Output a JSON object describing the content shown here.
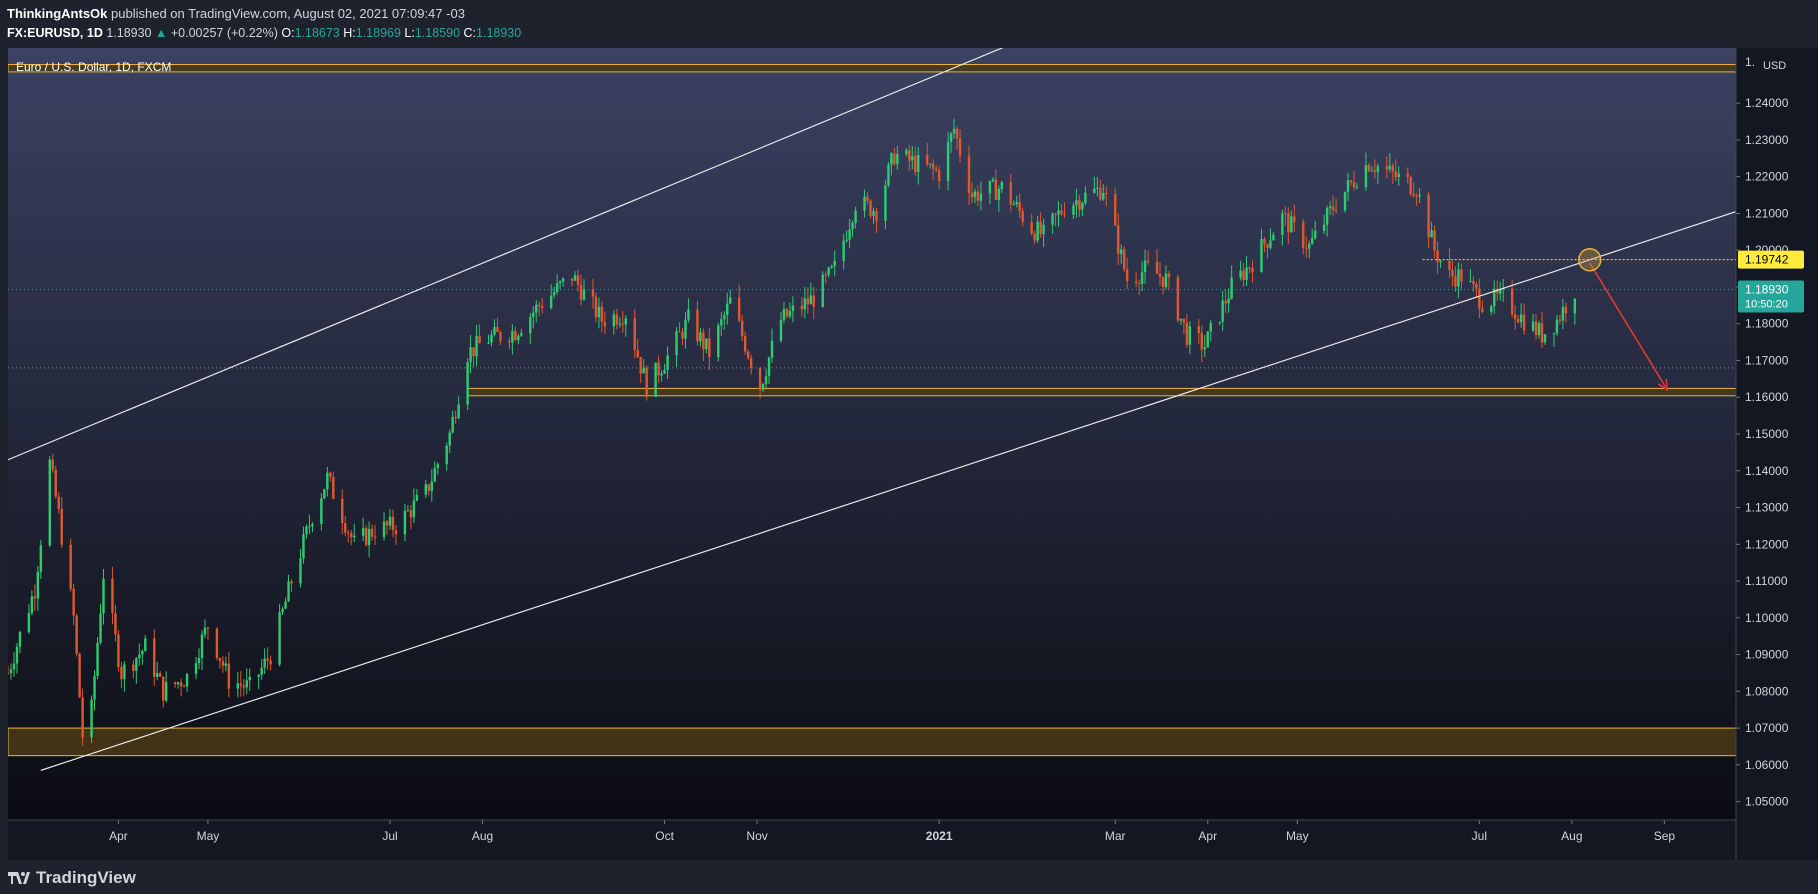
{
  "header": {
    "author": "ThinkingAntsOk",
    "published_text": "published on TradingView.com, August 02, 2021 07:09:47 -03",
    "symbol": "FX:EURUSD, 1D",
    "last": "1.18930",
    "change": "+0.00257 (+0.22%)",
    "open_label": "O:",
    "open": "1.18673",
    "high_label": "H:",
    "high": "1.18969",
    "low_label": "L:",
    "low": "1.18590",
    "close_label": "C:",
    "close": "1.18930"
  },
  "footer": {
    "brand": "TradingView"
  },
  "colors": {
    "background_top": "#3b4262",
    "background_bottom": "#0b0c12",
    "up": "#26a69a",
    "up_candle": "#2ecc71",
    "down_candle": "#e0582b",
    "zone_fill": "#4a3a14",
    "zone_border": "#f0b43a",
    "trend_line": "#e8e8e8",
    "arrow": "#e53935",
    "highlight_label": "#ffeb3b",
    "price_label": "#26a69a"
  },
  "chart_data": {
    "type": "candlestick",
    "title": "Euro / U.S. Dollar, 1D, FXCM",
    "currency": "USD",
    "x_range": [
      "2020-02-24",
      "2021-09-25"
    ],
    "ylim": [
      1.045,
      1.255
    ],
    "y_ticks": [
      "1.05000",
      "1.06000",
      "1.07000",
      "1.08000",
      "1.09000",
      "1.10000",
      "1.11000",
      "1.12000",
      "1.13000",
      "1.14000",
      "1.15000",
      "1.16000",
      "1.17000",
      "1.18000",
      "1.19000",
      "1.20000",
      "1.21000",
      "1.22000",
      "1.23000",
      "1.24000"
    ],
    "y_axis_top_label": "1.",
    "x_ticks": [
      {
        "label": "Apr",
        "date": "2020-04-01"
      },
      {
        "label": "May",
        "date": "2020-05-01"
      },
      {
        "label": "Jul",
        "date": "2020-07-01"
      },
      {
        "label": "Aug",
        "date": "2020-08-01"
      },
      {
        "label": "Oct",
        "date": "2020-10-01"
      },
      {
        "label": "Nov",
        "date": "2020-11-01"
      },
      {
        "label": "2021",
        "date": "2021-01-01"
      },
      {
        "label": "Mar",
        "date": "2021-03-01"
      },
      {
        "label": "Apr",
        "date": "2021-04-01"
      },
      {
        "label": "May",
        "date": "2021-05-01"
      },
      {
        "label": "Jul",
        "date": "2021-07-01"
      },
      {
        "label": "Aug",
        "date": "2021-08-01"
      },
      {
        "label": "Sep",
        "date": "2021-09-01"
      }
    ],
    "close_path": [
      [
        "2020-02-24",
        1.085
      ],
      [
        "2020-03-04",
        1.108
      ],
      [
        "2020-03-09",
        1.142
      ],
      [
        "2020-03-12",
        1.128
      ],
      [
        "2020-03-17",
        1.1
      ],
      [
        "2020-03-20",
        1.068
      ],
      [
        "2020-03-23",
        1.075
      ],
      [
        "2020-03-27",
        1.112
      ],
      [
        "2020-04-02",
        1.085
      ],
      [
        "2020-04-10",
        1.092
      ],
      [
        "2020-04-16",
        1.08
      ],
      [
        "2020-04-24",
        1.084
      ],
      [
        "2020-05-01",
        1.098
      ],
      [
        "2020-05-08",
        1.083
      ],
      [
        "2020-05-15",
        1.081
      ],
      [
        "2020-05-22",
        1.09
      ],
      [
        "2020-05-29",
        1.11
      ],
      [
        "2020-06-05",
        1.128
      ],
      [
        "2020-06-10",
        1.138
      ],
      [
        "2020-06-19",
        1.12
      ],
      [
        "2020-06-26",
        1.124
      ],
      [
        "2020-07-03",
        1.125
      ],
      [
        "2020-07-13",
        1.134
      ],
      [
        "2020-07-21",
        1.15
      ],
      [
        "2020-07-27",
        1.172
      ],
      [
        "2020-08-03",
        1.176
      ],
      [
        "2020-08-12",
        1.178
      ],
      [
        "2020-08-20",
        1.185
      ],
      [
        "2020-08-31",
        1.193
      ],
      [
        "2020-09-10",
        1.181
      ],
      [
        "2020-09-18",
        1.183
      ],
      [
        "2020-09-25",
        1.163
      ],
      [
        "2020-10-02",
        1.171
      ],
      [
        "2020-10-09",
        1.181
      ],
      [
        "2020-10-16",
        1.172
      ],
      [
        "2020-10-23",
        1.186
      ],
      [
        "2020-11-02",
        1.163
      ],
      [
        "2020-11-09",
        1.181
      ],
      [
        "2020-11-20",
        1.187
      ],
      [
        "2020-11-27",
        1.195
      ],
      [
        "2020-12-04",
        1.213
      ],
      [
        "2020-12-11",
        1.211
      ],
      [
        "2020-12-17",
        1.226
      ],
      [
        "2021-01-01",
        1.221
      ],
      [
        "2021-01-06",
        1.233
      ],
      [
        "2021-01-12",
        1.215
      ],
      [
        "2021-01-22",
        1.217
      ],
      [
        "2021-02-01",
        1.206
      ],
      [
        "2021-02-05",
        1.204
      ],
      [
        "2021-02-12",
        1.212
      ],
      [
        "2021-02-25",
        1.217
      ],
      [
        "2021-03-05",
        1.192
      ],
      [
        "2021-03-12",
        1.195
      ],
      [
        "2021-03-18",
        1.192
      ],
      [
        "2021-03-25",
        1.177
      ],
      [
        "2021-03-31",
        1.174
      ],
      [
        "2021-04-09",
        1.19
      ],
      [
        "2021-04-16",
        1.197
      ],
      [
        "2021-04-26",
        1.209
      ],
      [
        "2021-05-05",
        1.201
      ],
      [
        "2021-05-14",
        1.213
      ],
      [
        "2021-05-25",
        1.224
      ],
      [
        "2021-06-01",
        1.221
      ],
      [
        "2021-06-10",
        1.217
      ],
      [
        "2021-06-16",
        1.2
      ],
      [
        "2021-06-21",
        1.193
      ],
      [
        "2021-06-25",
        1.193
      ],
      [
        "2021-07-02",
        1.186
      ],
      [
        "2021-07-09",
        1.187
      ],
      [
        "2021-07-16",
        1.181
      ],
      [
        "2021-07-22",
        1.177
      ],
      [
        "2021-07-27",
        1.181
      ],
      [
        "2021-08-02",
        1.1893
      ]
    ],
    "zones": [
      {
        "from": 1.2485,
        "to": 1.2505
      },
      {
        "from": 1.1604,
        "to": 1.1624,
        "start": "2020-07-27"
      },
      {
        "from": 1.0625,
        "to": 1.07
      }
    ],
    "trend_lines": [
      {
        "from": [
          "2020-02-24",
          1.143
        ],
        "to": [
          "2021-01-25",
          1.256
        ]
      },
      {
        "from": [
          "2020-03-06",
          1.0585
        ],
        "to": [
          "2021-09-25",
          1.2105
        ]
      }
    ],
    "dotted_levels": [
      1.1893,
      1.168
    ],
    "resistance_level": {
      "value": 1.19742,
      "start": "2021-06-12"
    },
    "circle_marker": [
      "2021-08-07",
      1.1974
    ],
    "arrow": {
      "from": [
        "2021-08-07",
        1.1965
      ],
      "to": [
        "2021-09-02",
        1.162
      ]
    },
    "price_labels": [
      {
        "value": "1.19742",
        "style": "highlight"
      },
      {
        "value": "1.18930",
        "sub": "10:50:20",
        "style": "last"
      }
    ],
    "grid": false,
    "legend": "top-left"
  }
}
